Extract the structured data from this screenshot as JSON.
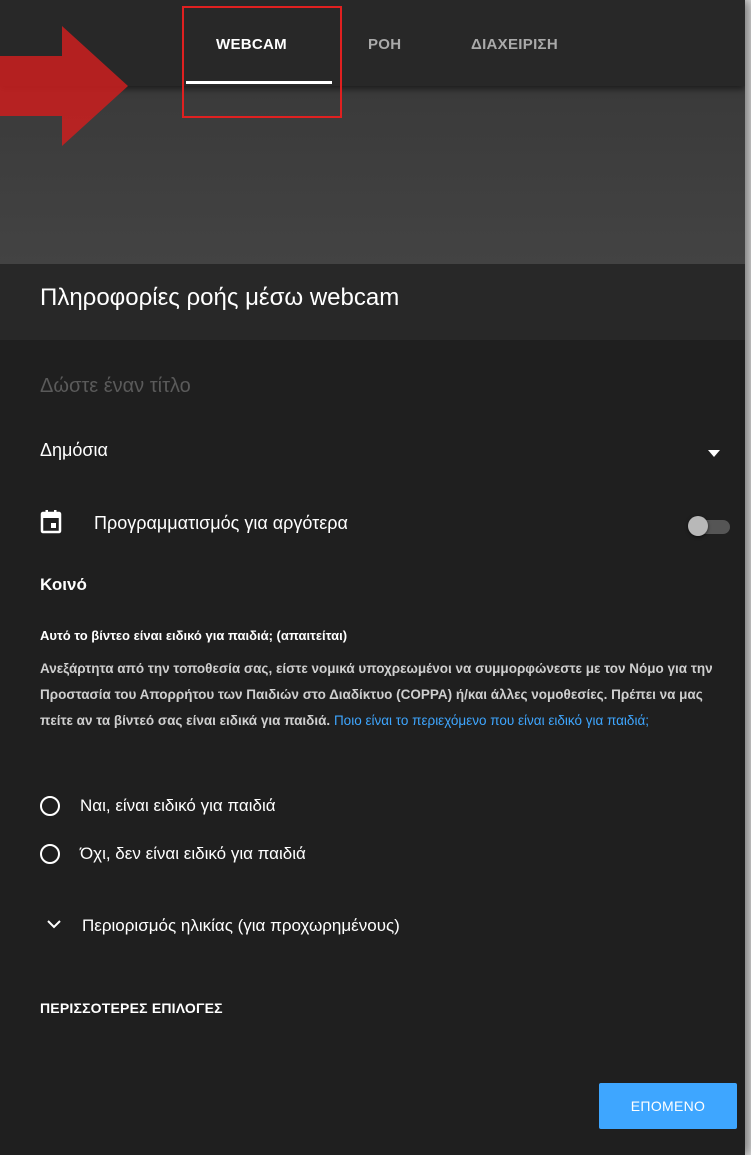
{
  "tabs": [
    {
      "label": "WEBCAM",
      "active": true
    },
    {
      "label": "ΡΟΗ",
      "active": false
    },
    {
      "label": "ΔΙΑΧΕΙΡΙΣΗ",
      "active": false
    }
  ],
  "header": {
    "title": "Πληροφορίες ροής μέσω webcam"
  },
  "form": {
    "title_placeholder": "Δώστε έναν τίτλο",
    "title_value": "",
    "visibility": "Δημόσια",
    "schedule_label": "Προγραμματισμός για αργότερα",
    "schedule_enabled": false
  },
  "audience": {
    "title": "Κοινό",
    "question": "Αυτό το βίντεο είναι ειδικό για παιδιά; (απαιτείται)",
    "description": "Ανεξάρτητα από την τοποθεσία σας, είστε νομικά υποχρεωμένοι να συμμορφώνεστε με τον Νόμο για την Προστασία του Απορρήτου των Παιδιών στο Διαδίκτυο (COPPA) ή/και άλλες νομοθεσίες. Πρέπει να μας πείτε αν τα βίντεό σας είναι ειδικά για παιδιά.",
    "link": "Ποιο είναι το περιεχόμενο που είναι ειδικό για παιδιά;",
    "options": [
      "Ναι, είναι ειδικό για παιδιά",
      "Όχι, δεν είναι ειδικό για παιδιά"
    ],
    "age_restriction": "Περιορισμός ηλικίας (για προχωρημένους)"
  },
  "more_options": "ΠΕΡΙΣΣΟΤΕΡΕΣ ΕΠΙΛΟΓΕΣ",
  "next_label": "ΕΠΟΜΕΝΟ",
  "icons": {
    "dropdown": "dropdown-arrow-icon",
    "schedule": "calendar-icon",
    "age": "chevron-down-icon",
    "annotation": "red-arrow-icon"
  },
  "colors": {
    "background": "#1f1f1f",
    "tab_bar": "#282828",
    "accent": "#3ea6ff",
    "annotation": "#e02020"
  }
}
